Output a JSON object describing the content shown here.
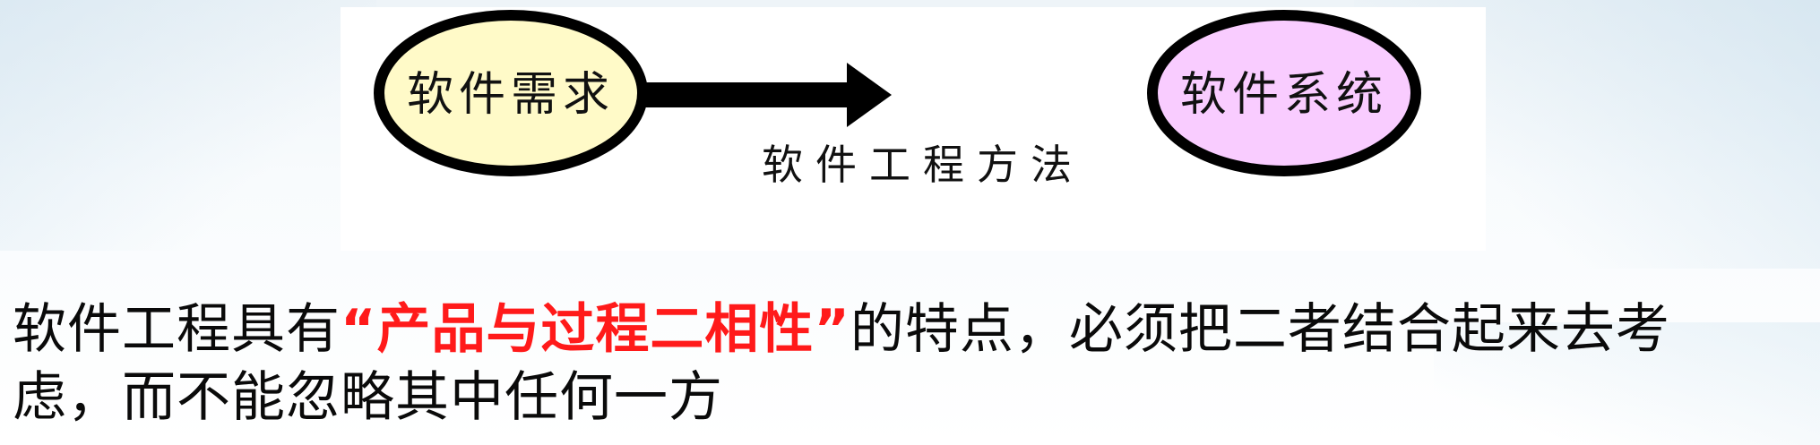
{
  "diagram": {
    "nodes": [
      {
        "id": "requirement",
        "label": "软件需求",
        "fill": "#fffac8",
        "stroke": "#000000"
      },
      {
        "id": "system",
        "label": "软件系统",
        "fill": "#f9ccff",
        "stroke": "#000000"
      }
    ],
    "edge": {
      "from": "requirement",
      "to": "system",
      "label": "软件工程方法"
    }
  },
  "caption": {
    "before": "软件工程具有",
    "open_quote": "“",
    "highlight": "产品与过程二相性",
    "close_quote": "”",
    "after_line1": "的特点，必须把二者结合起来去考",
    "line2": "虑，而不能忽略其中任何一方",
    "highlight_color": "#ff1a1a"
  }
}
